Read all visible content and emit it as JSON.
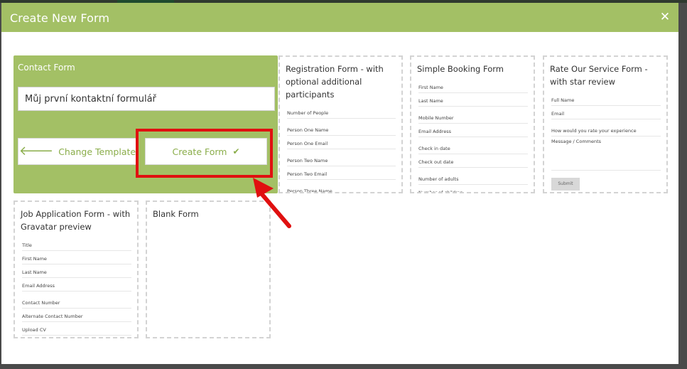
{
  "header": {
    "title": "Create New Form",
    "close_glyph": "✕"
  },
  "selected_template": {
    "label": "Contact Form",
    "form_name_value": "Můj první kontaktní formulář",
    "change_button": {
      "label": "Change Template",
      "icon": "arrow-left-icon"
    },
    "create_button": {
      "label": "Create Form",
      "icon": "check-icon"
    }
  },
  "templates": {
    "registration": {
      "title": "Registration Form - with optional additional participants",
      "fields": [
        "Number of People",
        "Person One Name",
        "Person One Email",
        "Person Two Name",
        "Person Two Email",
        "Person Three Name"
      ]
    },
    "booking": {
      "title": "Simple Booking Form",
      "fields": [
        "First Name",
        "Last Name",
        "Mobile Number",
        "Email Address",
        "Check in date",
        "Check out date",
        "Number of adults",
        "Number of children"
      ]
    },
    "rate": {
      "title": "Rate Our Service Form - with star review",
      "fields": [
        "Full Name",
        "Email",
        "How would you rate your experience",
        "Message / Comments"
      ],
      "submit": "Submit"
    },
    "job": {
      "title": "Job Application Form - with Gravatar preview",
      "fields": [
        "Title",
        "First Name",
        "Last Name",
        "Email Address",
        "Contact Number",
        "Alternate Contact Number",
        "Upload CV"
      ]
    },
    "blank": {
      "title": "Blank Form"
    }
  },
  "colors": {
    "header": "#a3c065",
    "accent_text": "#8aad4a",
    "highlight": "#e01010"
  }
}
